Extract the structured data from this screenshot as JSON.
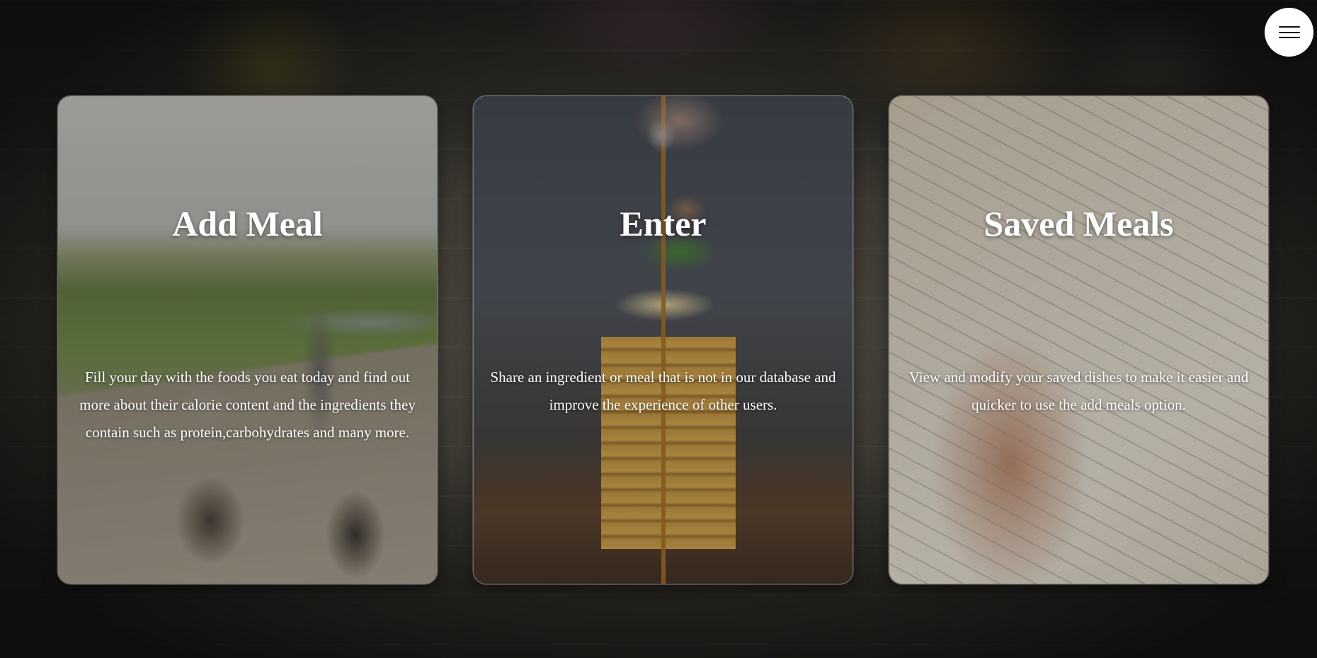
{
  "header": {
    "menu_icon": "hamburger-menu-icon"
  },
  "cards": [
    {
      "title": "Add Meal",
      "description": "Fill your day with the foods you eat today and find out more about their calorie content and the ingredients they contain such as protein,carbohydrates and many more."
    },
    {
      "title": "Enter",
      "description": "Share an ingredient or meal that is not in our database and improve the experience of other users."
    },
    {
      "title": "Saved Meals",
      "description": "View and modify your saved dishes to make it easier and quicker to use the add meals option."
    }
  ]
}
